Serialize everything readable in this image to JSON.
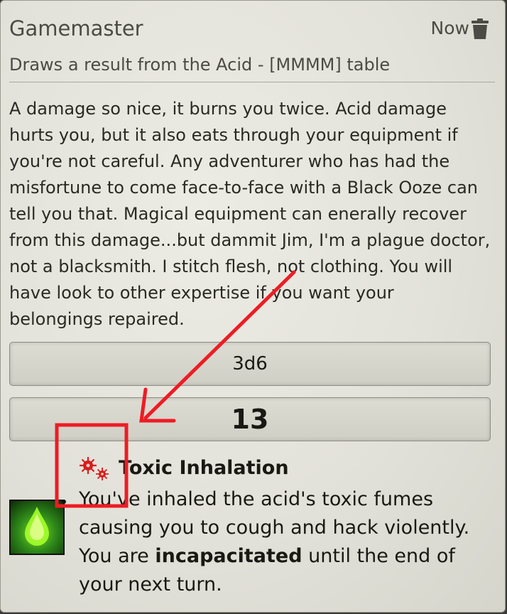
{
  "message": {
    "speaker": "Gamemaster",
    "timestamp": "Now",
    "delete_icon": "trash-icon",
    "flavor": "Draws a result from the Acid - [MMMM] table",
    "description": "A damage so nice, it burns you twice. Acid damage hurts you, but it also eats through your equipment if you're not careful. Any adventurer who has had the misfortune to come face-to-face with a Black Ooze can tell you that. Magical equipment can enerally recover from this damage...but dammit Jim, I'm a plague doctor, not a blacksmith. I stitch flesh, not clothing. You will have look to other expertise if you want your belongings repaired."
  },
  "roll": {
    "formula": "3d6",
    "total": "13"
  },
  "result": {
    "icon": "acid-drop-icon",
    "condition_icon": "virus-icon",
    "title": "Toxic Inhalation",
    "body_before": "You've inhaled the acid's toxic fumes causing you to cough and hack violently. You are ",
    "body_bold": "incapacitated",
    "body_after": " until the end of your next turn."
  },
  "annotation": {
    "color": "#ee1c24"
  }
}
